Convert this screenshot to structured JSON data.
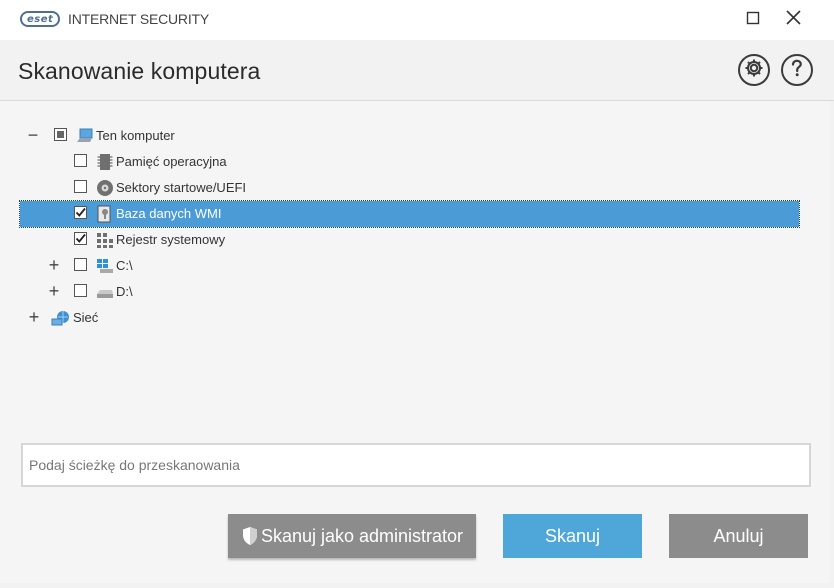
{
  "app": {
    "logo_text": "eset",
    "product_name": "INTERNET SECURITY"
  },
  "page": {
    "title": "Skanowanie komputera"
  },
  "icons": {
    "window_maximize": "maximize-icon",
    "window_close": "close-icon",
    "settings": "gear-icon",
    "help": "help-icon"
  },
  "tree": [
    {
      "label": "Ten komputer",
      "expander": "−",
      "checkbox": "partial",
      "icon": "computer-icon"
    },
    {
      "label": "Pamięć operacyjna",
      "checkbox": "unchecked",
      "icon": "memory-chip-icon"
    },
    {
      "label": "Sektory startowe/UEFI",
      "checkbox": "unchecked",
      "icon": "disk-icon"
    },
    {
      "label": "Baza danych WMI",
      "checkbox": "checked",
      "icon": "wmi-database-icon",
      "selected": true
    },
    {
      "label": "Rejestr systemowy",
      "checkbox": "checked",
      "icon": "registry-icon"
    },
    {
      "label": "C:\\",
      "expander": "+",
      "checkbox": "unchecked",
      "icon": "windows-drive-icon"
    },
    {
      "label": "D:\\",
      "expander": "+",
      "checkbox": "unchecked",
      "icon": "drive-icon"
    },
    {
      "label": "Sieć",
      "expander": "+",
      "icon": "network-icon"
    }
  ],
  "path_input": {
    "placeholder": "Podaj ścieżkę do przeskanowania",
    "value": ""
  },
  "buttons": {
    "scan_as_admin": "Skanuj jako administrator",
    "scan": "Skanuj",
    "cancel": "Anuluj"
  },
  "colors": {
    "selection": "#4a9bd6",
    "primary_button": "#4fa6d8",
    "secondary_button": "#8c8c8c"
  }
}
